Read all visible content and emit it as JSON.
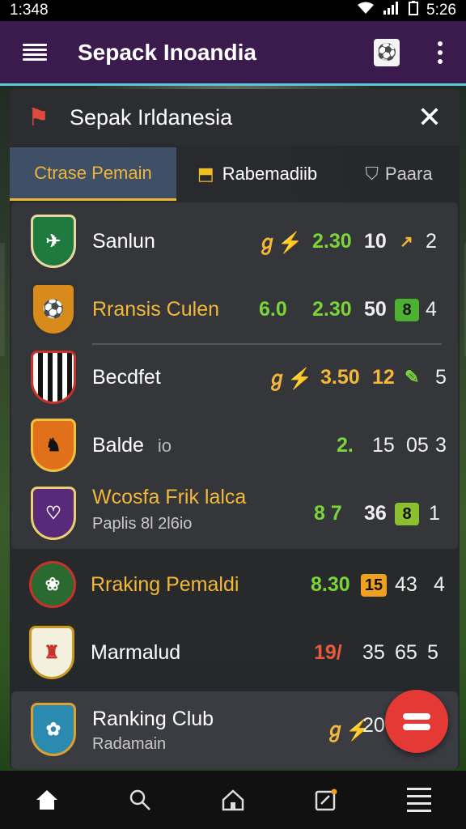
{
  "status": {
    "time_left": "1:348",
    "time_right": "5:26"
  },
  "appbar": {
    "title": "Sepack Inoandia"
  },
  "panel": {
    "title": "Sepak Irldanesia"
  },
  "tabs": [
    {
      "label": "Ctrase Pemain"
    },
    {
      "label": "Rabemadiib"
    },
    {
      "label": "Paara"
    }
  ],
  "rows": [
    {
      "name": "Sanlun",
      "s1": "2.30",
      "s2": "10",
      "s3": "2"
    },
    {
      "name": "Rransis Culen",
      "v0": "6.0",
      "s1": "2.30",
      "s2": "50",
      "badge": "8",
      "s3": "4"
    },
    {
      "name": "Becdfet",
      "s1": "3.50",
      "s2": "12",
      "s3": "5"
    },
    {
      "name": "Balde",
      "name2": "io",
      "s1": "2.",
      "s2": "15",
      "s3": "05",
      "s4": "3"
    },
    {
      "name": "Wcosfa Frik lalca",
      "sub": "Paplis 8l 2l6io",
      "s1": "8 7",
      "s2": "36",
      "badge": "8",
      "s3": "1"
    },
    {
      "name": "Rraking Pemaldi",
      "s1": "8.30",
      "badge": "15",
      "s2": "43",
      "s3": "4"
    },
    {
      "name": "Marmalud",
      "s1": "19/",
      "s2": "35",
      "s3": "65",
      "s4": "5"
    },
    {
      "name": "Ranking Club",
      "sub": "Radamain",
      "s1": "20"
    }
  ],
  "colors": {
    "appbar": "#3b1b4e",
    "accent": "#f0b63a",
    "green": "#7ad43a",
    "fab": "#e53935"
  }
}
